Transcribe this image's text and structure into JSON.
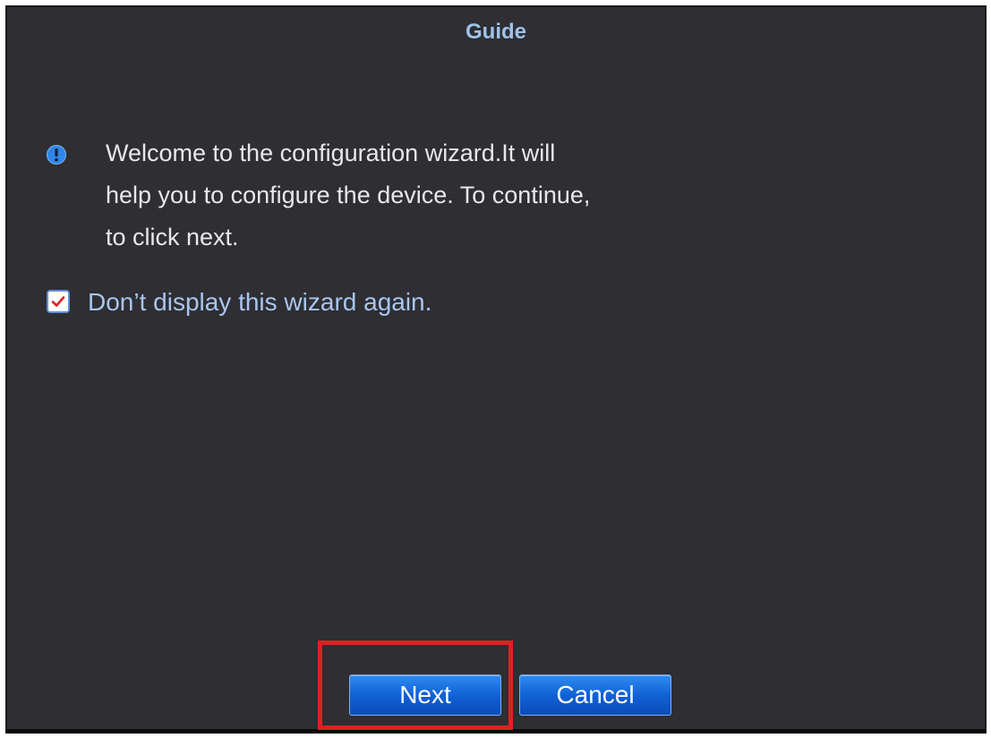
{
  "dialog": {
    "title": "Guide",
    "message": "Welcome to the configuration wizard.It will\nhelp you to configure the device. To continue,\nto click next.",
    "info_icon": "info-icon",
    "checkbox": {
      "label": "Don’t display this wizard again.",
      "checked": true
    },
    "buttons": {
      "next_label": "Next",
      "cancel_label": "Cancel"
    }
  },
  "colors": {
    "background": "#2e2e33",
    "title": "#9fc2ea",
    "button": "#1162d6",
    "highlight": "#e02020"
  }
}
